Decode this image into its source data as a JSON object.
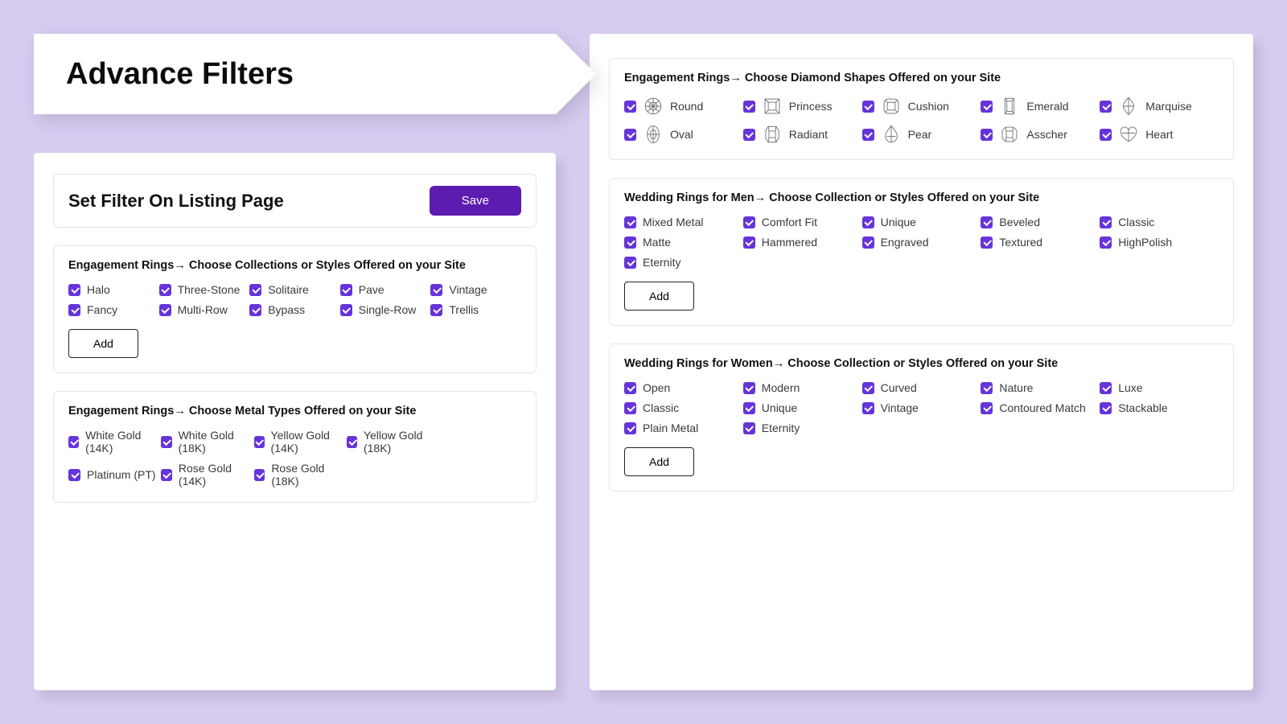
{
  "banner": {
    "title": "Advance Filters"
  },
  "titlebar": {
    "heading": "Set Filter On Listing Page",
    "save": "Save"
  },
  "addLabel": "Add",
  "sections": {
    "er_styles": {
      "title": "Engagement Rings→ Choose Collections or Styles Offered on your Site",
      "items": [
        "Halo",
        "Three-Stone",
        "Solitaire",
        "Pave",
        "Vintage",
        "Fancy",
        "Multi-Row",
        "Bypass",
        "Single-Row",
        "Trellis"
      ]
    },
    "er_metals": {
      "title": "Engagement Rings→ Choose Metal Types Offered on your Site",
      "items": [
        "White Gold (14K)",
        "White Gold (18K)",
        "Yellow Gold (14K)",
        "Yellow Gold (18K)",
        "Platinum (PT)",
        "Rose Gold (14K)",
        "Rose Gold (18K)"
      ]
    },
    "shapes": {
      "title": "Engagement Rings→ Choose Diamond Shapes Offered on your Site",
      "items": [
        {
          "label": "Round",
          "icon": "round"
        },
        {
          "label": "Princess",
          "icon": "princess"
        },
        {
          "label": "Cushion",
          "icon": "cushion"
        },
        {
          "label": "Emerald",
          "icon": "emerald"
        },
        {
          "label": "Marquise",
          "icon": "marquise"
        },
        {
          "label": "Oval",
          "icon": "oval"
        },
        {
          "label": "Radiant",
          "icon": "radiant"
        },
        {
          "label": "Pear",
          "icon": "pear"
        },
        {
          "label": "Asscher",
          "icon": "asscher"
        },
        {
          "label": "Heart",
          "icon": "heart"
        }
      ]
    },
    "men": {
      "title": "Wedding Rings for Men→ Choose Collection or Styles Offered on your Site",
      "items": [
        "Mixed Metal",
        "Comfort Fit",
        "Unique",
        "Beveled",
        "Classic",
        "Matte",
        "Hammered",
        "Engraved",
        "Textured",
        "HighPolish",
        "Eternity"
      ]
    },
    "women": {
      "title": "Wedding Rings for Women→ Choose Collection or Styles Offered on your Site",
      "items": [
        "Open",
        "Modern",
        "Curved",
        "Nature",
        "Luxe",
        "Classic",
        "Unique",
        "Vintage",
        "Contoured Match",
        "Stackable",
        "Plain Metal",
        "Eternity"
      ]
    }
  }
}
